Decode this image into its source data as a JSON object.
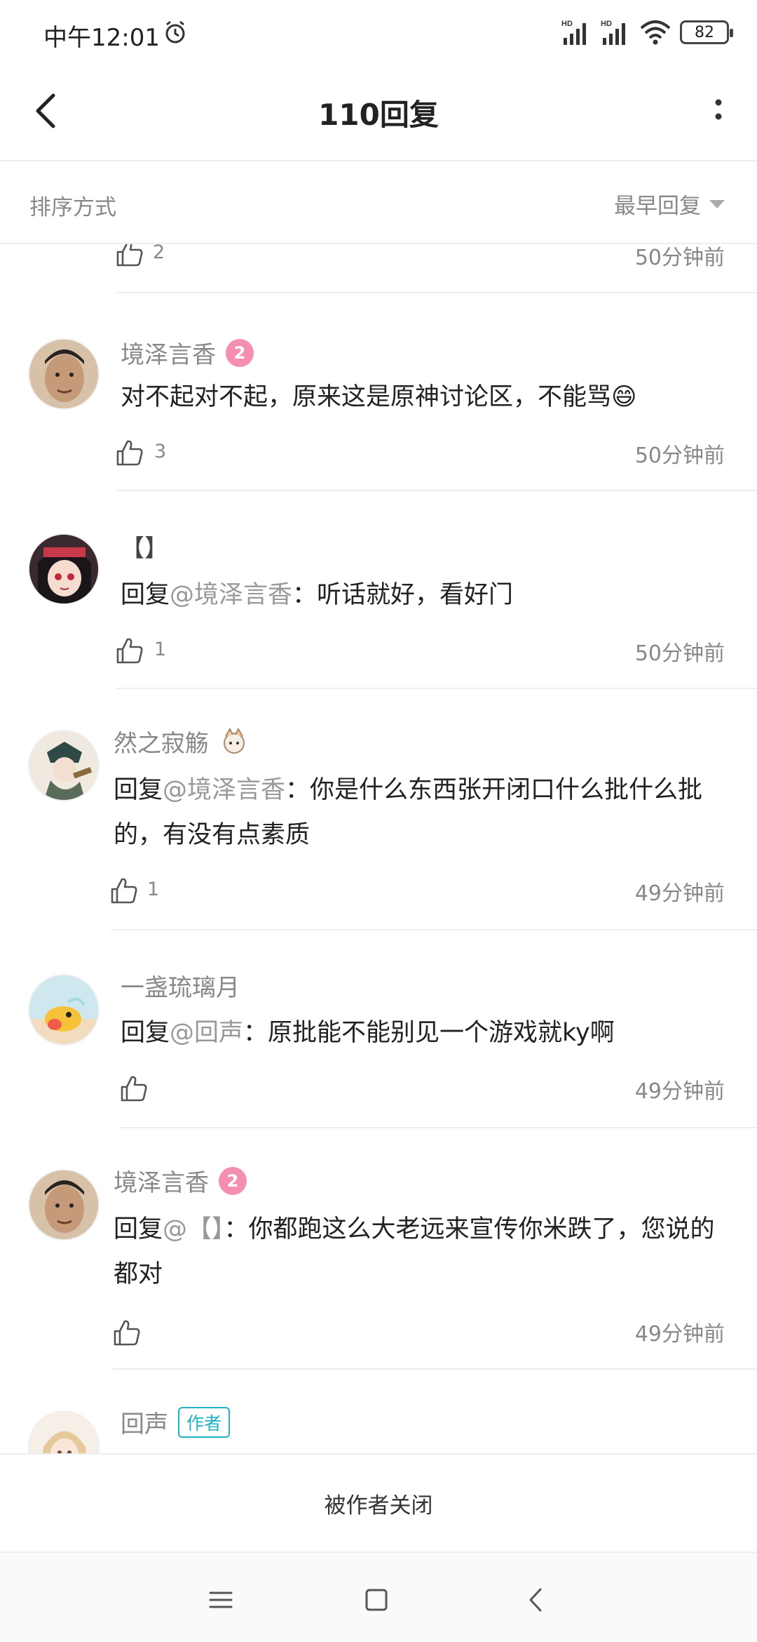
{
  "status_bar": {
    "time": "中午12:01",
    "signal1_label": "HD",
    "signal2_label": "HD",
    "battery": "82"
  },
  "header": {
    "title": "110回复",
    "back_icon": "chevron-left-icon",
    "more_icon": "more-vertical-icon"
  },
  "sort": {
    "label": "排序方式",
    "selected": "最早回复"
  },
  "partial_comment": {
    "likes": "2",
    "time": "50分钟前"
  },
  "comments": [
    {
      "name": "境泽言香",
      "level": "2",
      "text": "对不起对不起，原来这是原神讨论区，不能骂😄",
      "reply_prefix": "",
      "mention": "",
      "likes": "3",
      "time": "50分钟前"
    },
    {
      "name": "【】",
      "reply_prefix": "回复",
      "mention": "@境泽言香",
      "text": "：听话就好，看好门",
      "likes": "1",
      "time": "50分钟前"
    },
    {
      "name": "然之寂觞",
      "reply_prefix": "回复",
      "mention": "@境泽言香",
      "text": "：你是什么东西张开闭口什么批什么批的，有没有点素质",
      "likes": "1",
      "time": "49分钟前"
    },
    {
      "name": "一盏琉璃月",
      "reply_prefix": "回复",
      "mention": "@回声",
      "text": "：原批能不能别见一个游戏就ky啊",
      "likes": "",
      "time": "49分钟前"
    },
    {
      "name": "境泽言香",
      "level": "2",
      "reply_prefix": "回复",
      "mention": "@【】",
      "text": "：你都跑这么大老远来宣传你米跌了，您说的都对",
      "likes": "",
      "time": "49分钟前"
    },
    {
      "name": "回声",
      "author_tag": "作者"
    }
  ],
  "closed_notice": "被作者关闭",
  "nav": {
    "menu_icon": "menu-icon",
    "home_icon": "home-square-icon",
    "back_icon": "back-triangle-icon"
  }
}
